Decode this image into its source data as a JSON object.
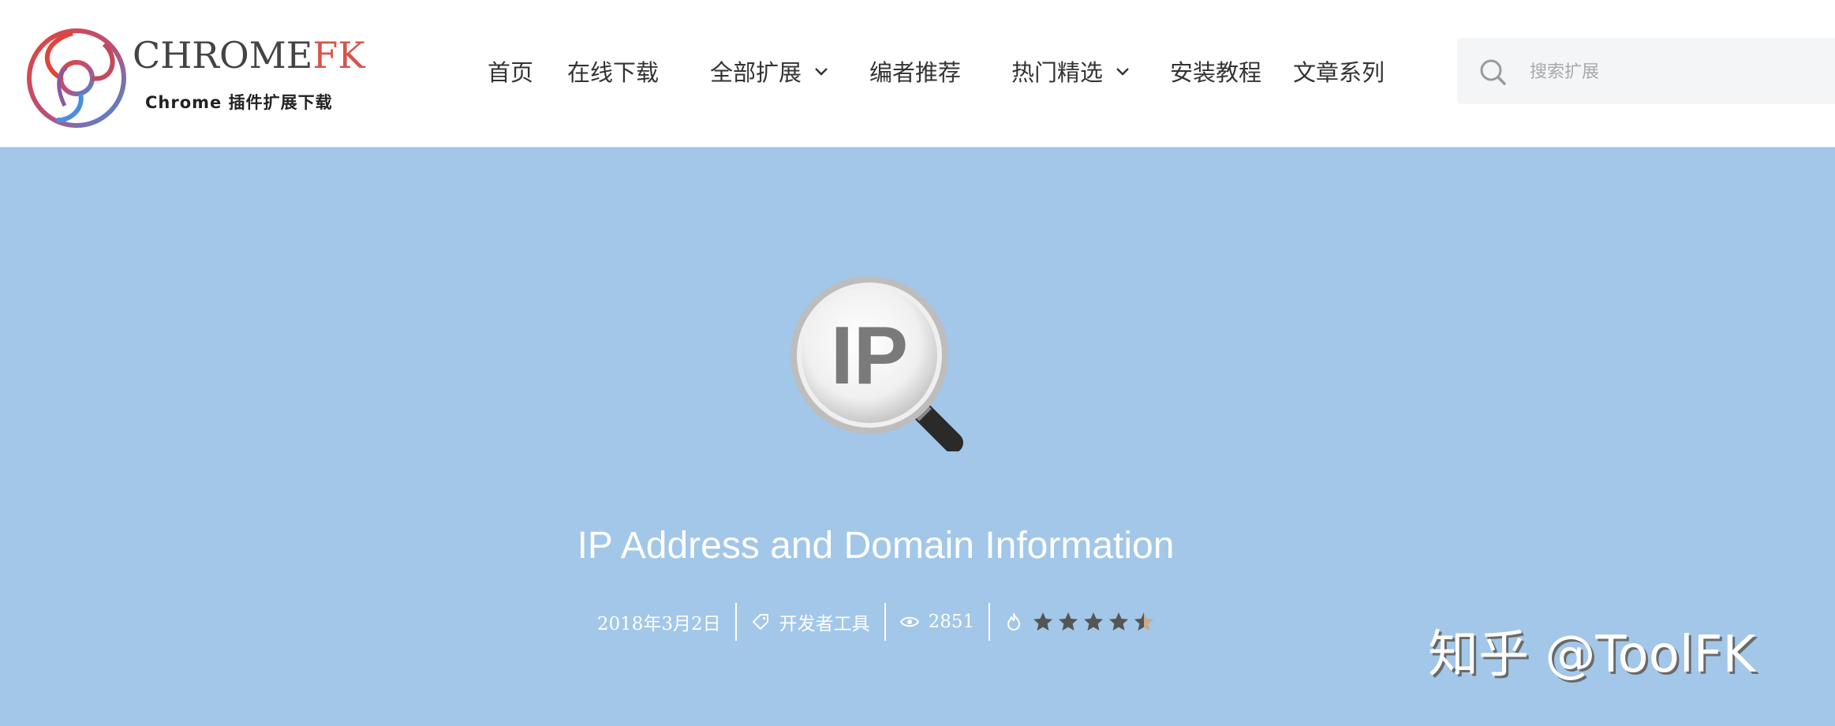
{
  "header": {
    "logo": {
      "brand_primary": "CHROME",
      "brand_accent": "FK",
      "tagline": "Chrome 插件扩展下载"
    },
    "nav": [
      {
        "label": "首页",
        "has_dropdown": false
      },
      {
        "label": "在线下载",
        "has_dropdown": false
      },
      {
        "label": "全部扩展",
        "has_dropdown": true
      },
      {
        "label": "编者推荐",
        "has_dropdown": false
      },
      {
        "label": "热门精选",
        "has_dropdown": true
      },
      {
        "label": "安装教程",
        "has_dropdown": false
      },
      {
        "label": "文章系列",
        "has_dropdown": false
      }
    ],
    "search": {
      "placeholder": "搜索扩展",
      "icon": "search-icon"
    }
  },
  "hero": {
    "icon": "ip-magnifier-icon",
    "title": "IP Address and Domain Information",
    "meta": {
      "date": "2018年3月2日",
      "category": "开发者工具",
      "category_icon": "tag-icon",
      "views": "2851",
      "views_icon": "eye-icon",
      "rating_icon": "flame-icon",
      "rating": 4.5,
      "rating_max": 5
    }
  },
  "watermark": "知乎 @ToolFK",
  "colors": {
    "hero_background": "#a2c7e8",
    "header_background": "#ffffff",
    "brand_accent": "#d6544c",
    "star": "#555555"
  }
}
